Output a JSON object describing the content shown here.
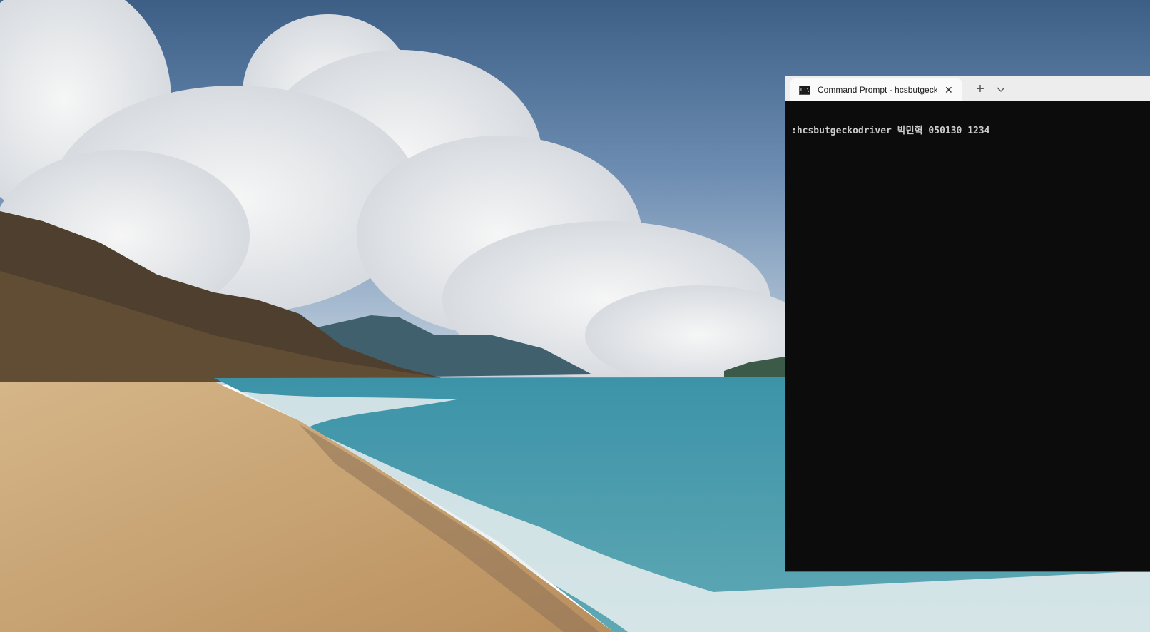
{
  "terminal": {
    "tab_title": "Command Prompt - hcsbutgeckodriver",
    "tab_icon": "cmd-icon",
    "close_icon": "close-icon",
    "new_tab_label": "+",
    "dropdown_icon": "chevron-down-icon",
    "console_lines": [
      ":hcsbutgeckodriver 박민혁 050130 1234"
    ]
  },
  "colors": {
    "terminal_background": "#0c0c0c",
    "console_text": "#cccccc",
    "titlebar": "#ededed",
    "active_tab": "#fafafa",
    "window_border": "#3a64c8"
  }
}
